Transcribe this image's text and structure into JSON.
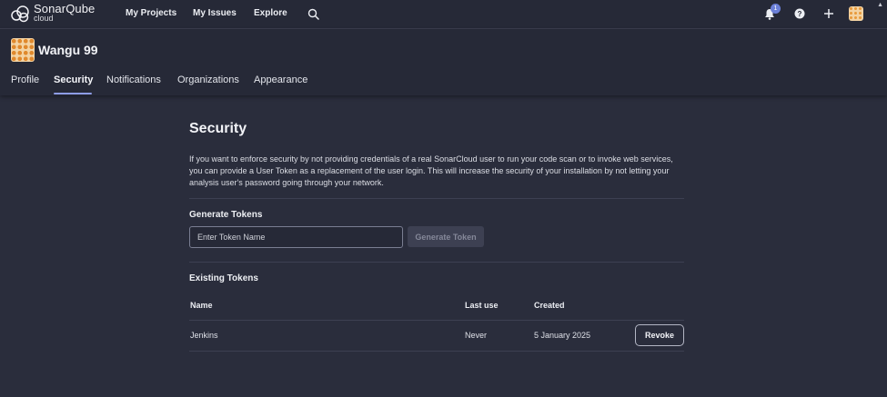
{
  "app": {
    "brand_name": "SonarQube",
    "brand_sub": "cloud"
  },
  "topnav": {
    "links": [
      "My Projects",
      "My Issues",
      "Explore"
    ],
    "notification_count": "1",
    "icons": [
      "search-icon",
      "bell-icon",
      "help-icon",
      "plus-icon",
      "user-avatar"
    ]
  },
  "profile": {
    "username": "Wangu 99"
  },
  "tabs": [
    {
      "label": "Profile",
      "active": false
    },
    {
      "label": "Security",
      "active": true
    },
    {
      "label": "Notifications",
      "active": false
    },
    {
      "label": "Organizations",
      "active": false
    },
    {
      "label": "Appearance",
      "active": false
    }
  ],
  "security": {
    "title": "Security",
    "description": "If you want to enforce security by not providing credentials of a real SonarCloud user to run your code scan or to invoke web services, you can provide a User Token as a replacement of the user login. This will increase the security of your installation by not letting your analysis user's password going through your network.",
    "generate_title": "Generate Tokens",
    "token_placeholder": "Enter Token Name",
    "generate_button": "Generate Token",
    "existing_title": "Existing Tokens",
    "columns": [
      "Name",
      "Last use",
      "Created"
    ],
    "tokens": [
      {
        "name": "Jenkins",
        "last_use": "Never",
        "created": "5 January 2025",
        "action": "Revoke"
      }
    ]
  },
  "colors": {
    "background": "#2a2d3c",
    "header": "#262937",
    "accent": "#8e9ce5",
    "badge": "#6b7fd7"
  }
}
